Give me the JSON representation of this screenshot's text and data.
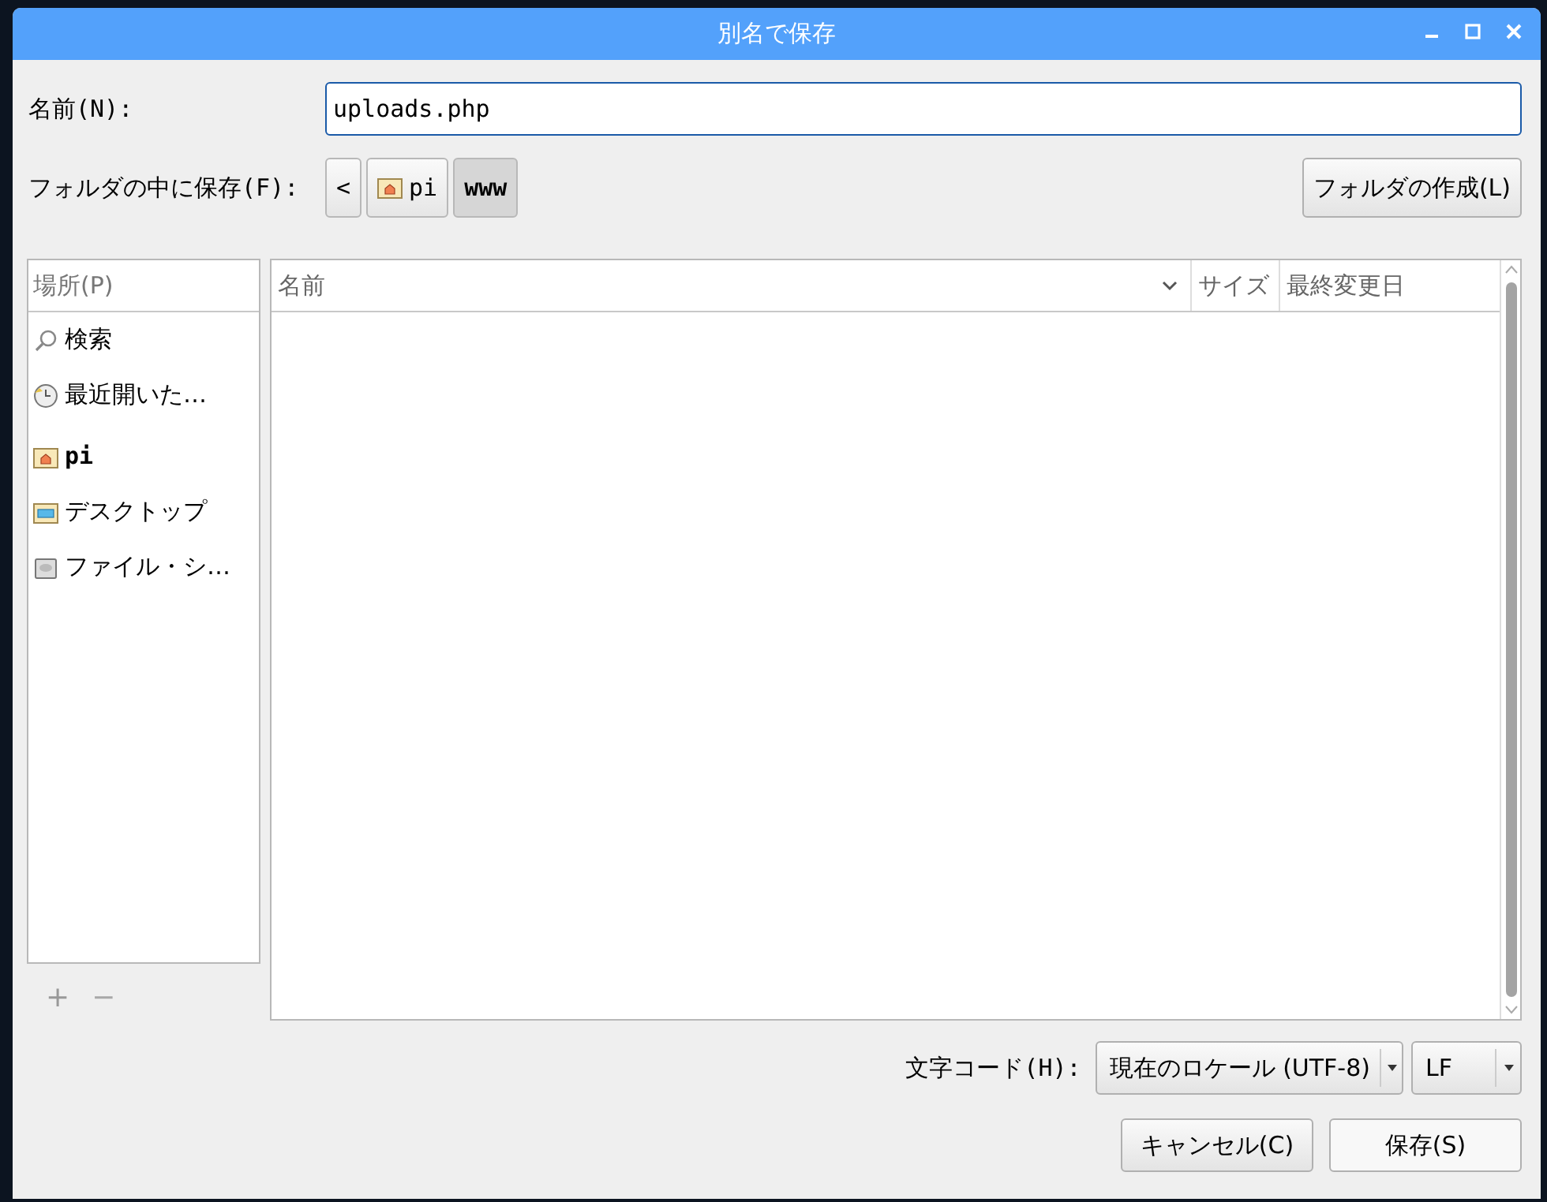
{
  "window": {
    "title": "別名で保存"
  },
  "name_field": {
    "label": "名前(N):",
    "value": "uploads.php"
  },
  "save_in": {
    "label": "フォルダの中に保存(F):",
    "path": [
      {
        "kind": "back",
        "label": "<",
        "selected": false
      },
      {
        "kind": "home",
        "label": "pi",
        "selected": false
      },
      {
        "kind": "folder",
        "label": "www",
        "selected": true
      }
    ],
    "create_folder": "フォルダの作成(L)"
  },
  "places": {
    "header": "場所(P)",
    "items": [
      {
        "kind": "search",
        "label": "検索"
      },
      {
        "kind": "recent",
        "label": "最近開いた…"
      },
      {
        "kind": "home",
        "label": "pi"
      },
      {
        "kind": "desktop",
        "label": "デスクトップ"
      },
      {
        "kind": "drive",
        "label": "ファイル・シ…"
      }
    ],
    "add": "+",
    "remove": "−"
  },
  "files": {
    "columns": [
      "名前",
      "サイズ",
      "最終変更日"
    ]
  },
  "encoding": {
    "label": "文字コード(H):",
    "value": "現在のロケール (UTF-8)",
    "line_ending": "LF"
  },
  "buttons": [
    "キャンセル(C)",
    "保存(S)"
  ]
}
